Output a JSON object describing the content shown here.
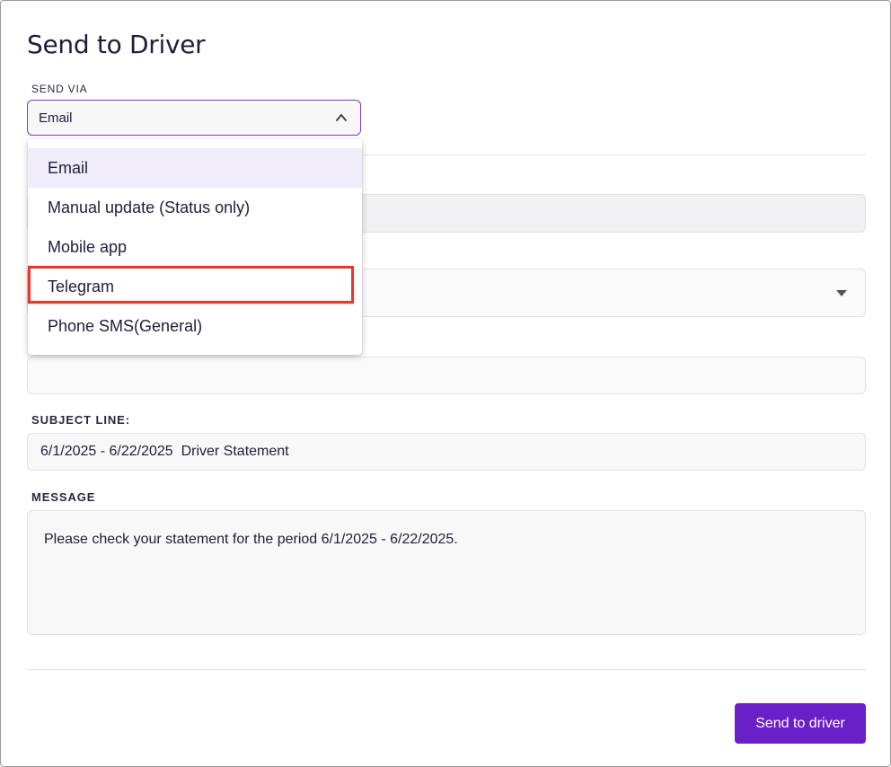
{
  "dialog": {
    "title": "Send to Driver"
  },
  "send_via": {
    "label": "SEND VIA",
    "selected": "Email",
    "options": [
      "Email",
      "Manual update (Status only)",
      "Mobile app",
      "Telegram",
      "Phone SMS(General)"
    ],
    "highlighted_option": "Telegram"
  },
  "subject": {
    "label": "SUBJECT LINE:",
    "value": "6/1/2025 - 6/22/2025  Driver Statement"
  },
  "message": {
    "label": "MESSAGE",
    "value": "Please check your statement for the period 6/1/2025 - 6/22/2025."
  },
  "actions": {
    "send_label": "Send to driver"
  },
  "colors": {
    "accent": "#6a1fc9",
    "select_border": "#7b3ac8",
    "selected_option_bg": "#f0ecfa",
    "highlight_box": "#e8362b"
  }
}
